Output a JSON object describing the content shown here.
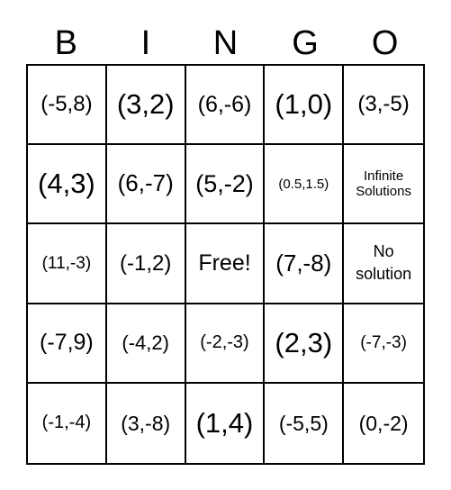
{
  "header": [
    "B",
    "I",
    "N",
    "G",
    "O"
  ],
  "cells": [
    [
      "(-5,8)",
      "(3,2)",
      "(6,-6)",
      "(1,0)",
      "(3,-5)"
    ],
    [
      "(4,3)",
      "(6,-7)",
      "(5,-2)",
      "(0.5,1.5)",
      "Infinite Solutions"
    ],
    [
      "(11,-3)",
      "(-1,2)",
      "Free!",
      "(7,-8)",
      "No solution"
    ],
    [
      "(-7,9)",
      "(-4,2)",
      "(-2,-3)",
      "(2,3)",
      "(-7,-3)"
    ],
    [
      "(-1,-4)",
      "(3,-8)",
      "(1,4)",
      "(-5,5)",
      "(0,-2)"
    ]
  ]
}
